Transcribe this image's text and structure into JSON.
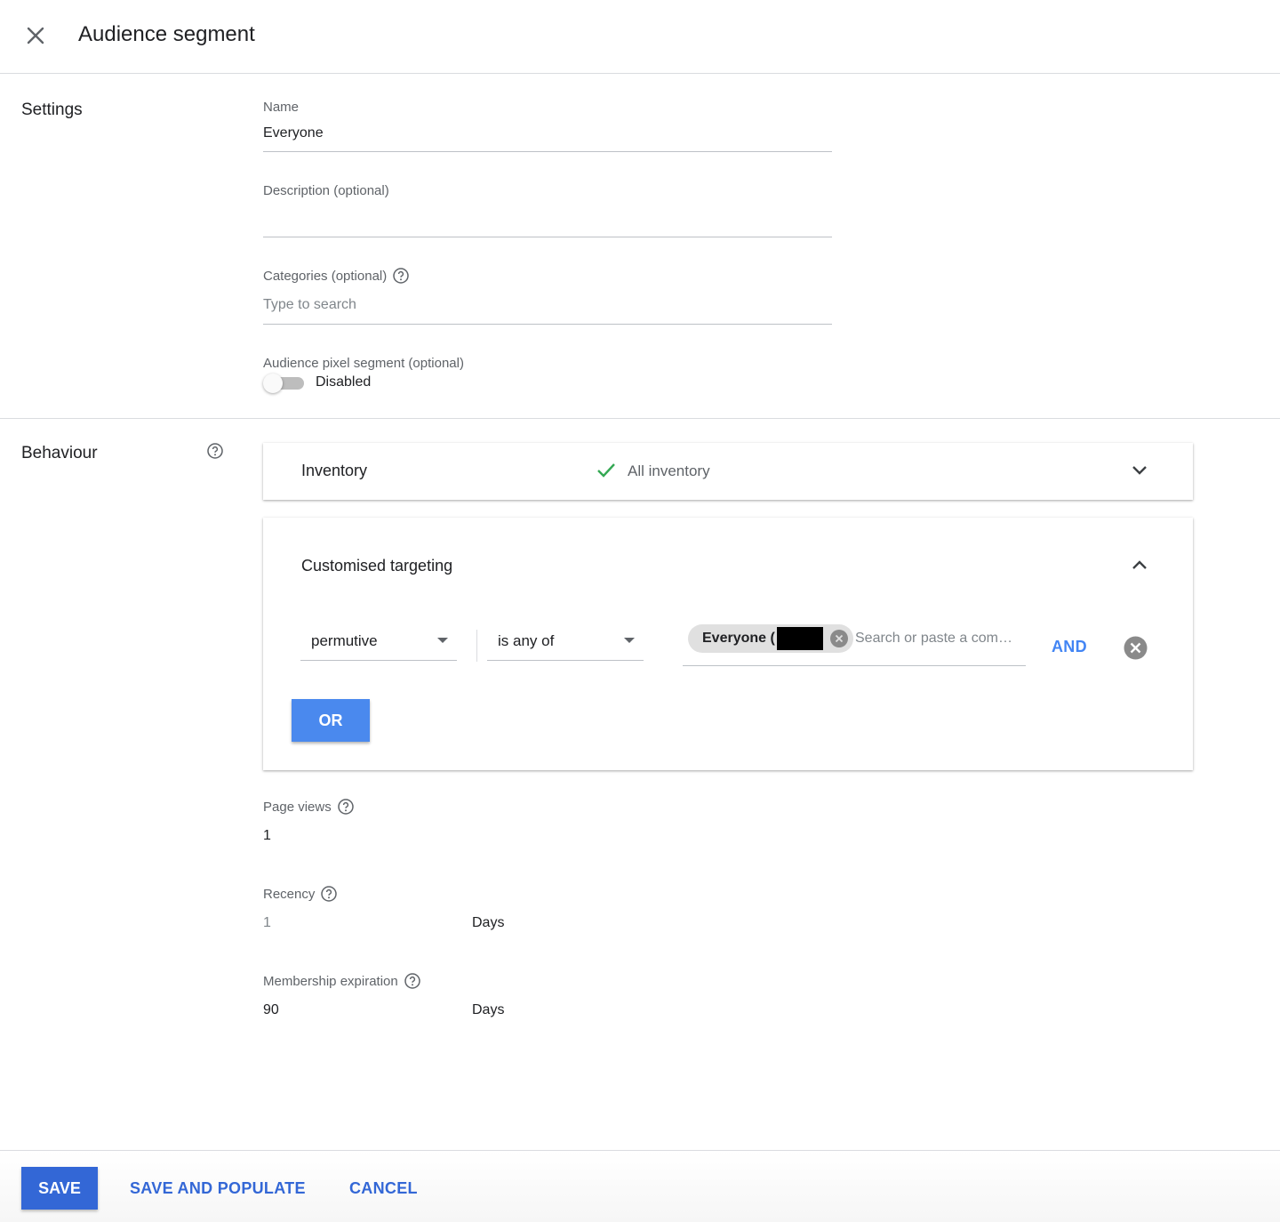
{
  "header": {
    "title": "Audience segment",
    "close_icon": "close-icon"
  },
  "settings": {
    "section_label": "Settings",
    "name": {
      "label": "Name",
      "value": "Everyone"
    },
    "description": {
      "label": "Description (optional)",
      "value": ""
    },
    "categories": {
      "label": "Categories (optional)",
      "placeholder": "Type to search"
    },
    "pixel_segment": {
      "label": "Audience pixel segment (optional)",
      "state": "Disabled",
      "enabled": false
    }
  },
  "behaviour": {
    "section_label": "Behaviour",
    "inventory": {
      "title": "Inventory",
      "status": "All inventory",
      "status_icon": "check-icon",
      "expand_icon": "chevron-down-icon"
    },
    "targeting": {
      "title": "Customised targeting",
      "collapse_icon": "chevron-up-icon",
      "key_select": "permutive",
      "operator_select": "is any of",
      "chip_label": "Everyone (",
      "search_placeholder": "Search or paste a com…",
      "and_label": "AND",
      "or_label": "OR"
    },
    "page_views": {
      "label": "Page views",
      "value": "1"
    },
    "recency": {
      "label": "Recency",
      "value": "1",
      "unit": "Days"
    },
    "membership": {
      "label": "Membership expiration",
      "value": "90",
      "unit": "Days"
    }
  },
  "footer": {
    "save": "SAVE",
    "save_populate": "SAVE AND POPULATE",
    "cancel": "CANCEL"
  },
  "colors": {
    "primary": "#3367d6",
    "accent": "#4285f4",
    "check": "#34a853"
  }
}
